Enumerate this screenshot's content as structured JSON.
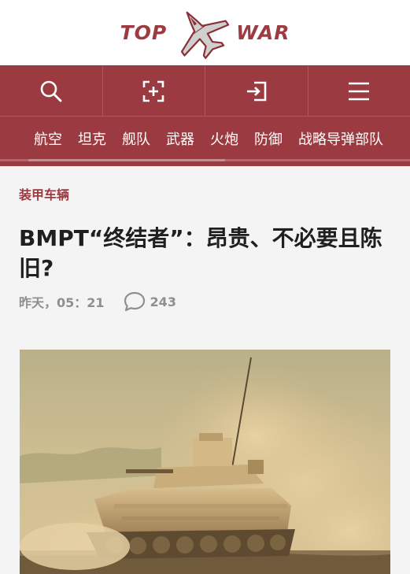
{
  "brand": {
    "logo_left": "TOP",
    "logo_right": "WAR"
  },
  "toolbar": [
    {
      "name": "search-button",
      "icon": "search-icon"
    },
    {
      "name": "login-button",
      "icon": "add-frame-icon"
    },
    {
      "name": "enter-button",
      "icon": "sign-in-icon"
    },
    {
      "name": "menu-button",
      "icon": "hamburger-menu-icon"
    }
  ],
  "nav": {
    "items": [
      "航空",
      "坦克",
      "舰队",
      "武器",
      "火炮",
      "防御",
      "战略导弹部队"
    ]
  },
  "article": {
    "category": "装甲车辆",
    "title": "BMPT“终结者”：昂贵、不必要且陈旧?",
    "date": "昨天，05：21",
    "comment_count": "243"
  },
  "colors": {
    "brand": "#9b3a40",
    "meta": "#8f8f8f",
    "title": "#1f1f1f"
  }
}
